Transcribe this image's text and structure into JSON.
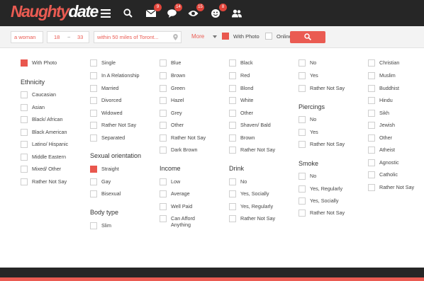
{
  "header": {
    "logo_part1": "Naughty",
    "logo_part2": "date",
    "badges": {
      "messages": "9",
      "chat": "14",
      "views": "15",
      "winks": "8"
    }
  },
  "search": {
    "seeking": "a woman",
    "age_min": "18",
    "age_sep": "~",
    "age_max": "33",
    "location": "within 50 miles of Toront...",
    "more_label": "More",
    "with_photo_label": "With Photo",
    "with_photo_checked": true,
    "online_now_label": "Online Now",
    "online_now_checked": false
  },
  "filters": {
    "col1": {
      "with_photo": {
        "label": "With Photo",
        "checked": true
      },
      "ethnicity": {
        "heading": "Ethnicity",
        "options": [
          "Caucasian",
          "Asian",
          "Black/ African",
          "Black American",
          "Latino/ Hispanic",
          "Middle Eastern",
          "Mixed/ Other",
          "Rather Not Say"
        ]
      }
    },
    "col2": {
      "status": {
        "options": [
          "Single",
          "In A Relationship",
          "Married",
          "Divorced",
          "Widowed",
          "Rather Not Say",
          "Separated"
        ]
      },
      "orientation": {
        "heading": "Sexual orientation",
        "options": [
          "Straight",
          "Gay",
          "Bisexual"
        ],
        "checked_index": 0
      },
      "body": {
        "heading": "Body type",
        "options": [
          "Slim"
        ]
      }
    },
    "col3": {
      "eyes": {
        "options": [
          "Blue",
          "Brown",
          "Green",
          "Hazel",
          "Grey",
          "Other",
          "Rather Not Say",
          "Dark Brown"
        ]
      },
      "income": {
        "heading": "Income",
        "options": [
          "Low",
          "Average",
          "Well Paid",
          "Can Afford Anything"
        ]
      }
    },
    "col4": {
      "hair": {
        "options": [
          "Black",
          "Red",
          "Blond",
          "White",
          "Other",
          "Shaven/ Bald",
          "Brown",
          "Rather Not Say"
        ]
      },
      "drink": {
        "heading": "Drink",
        "options": [
          "No",
          "Yes, Socially",
          "Yes, Regularly",
          "Rather Not Say"
        ]
      }
    },
    "col5": {
      "top": {
        "options": [
          "No",
          "Yes",
          "Rather Not Say"
        ]
      },
      "piercings": {
        "heading": "Piercings",
        "options": [
          "No",
          "Yes",
          "Rather Not Say"
        ]
      },
      "smoke": {
        "heading": "Smoke",
        "options": [
          "No",
          "Yes, Regularly",
          "Yes, Socially",
          "Rather Not Say"
        ]
      }
    },
    "col6": {
      "religion": {
        "options": [
          "Christian",
          "Muslim",
          "Buddhist",
          "Hindu",
          "Sikh",
          "Jewish",
          "Other",
          "Atheist",
          "Agnostic",
          "Catholic",
          "Rather Not Say"
        ]
      }
    }
  },
  "colors": {
    "accent": "#ea5b52",
    "header_bg": "#262626",
    "searchbar_bg": "#f3f3f3"
  }
}
